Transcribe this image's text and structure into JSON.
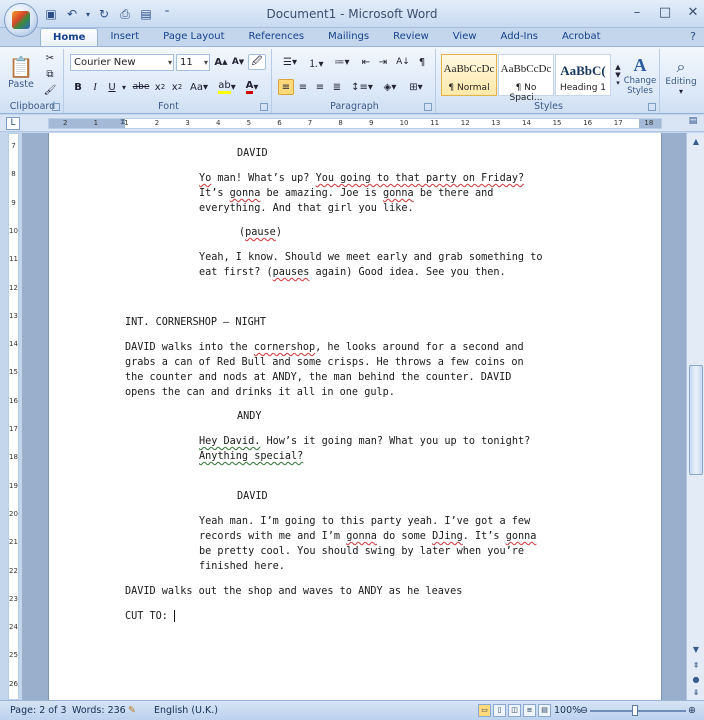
{
  "window": {
    "title": "Document1 - Microsoft Word",
    "minimize": "–",
    "maximize": "□",
    "close": "✕"
  },
  "qat": {
    "items": [
      "save-icon",
      "undo-icon",
      "redo-icon",
      "print-icon",
      "customize-icon"
    ]
  },
  "tabs": [
    "Home",
    "Insert",
    "Page Layout",
    "References",
    "Mailings",
    "Review",
    "View",
    "Add-Ins",
    "Acrobat"
  ],
  "active_tab": "Home",
  "ribbon": {
    "clipboard": {
      "label": "Clipboard",
      "paste": "Paste"
    },
    "font": {
      "label": "Font",
      "family": "Courier New",
      "size": "11"
    },
    "paragraph": {
      "label": "Paragraph"
    },
    "styles": {
      "label": "Styles",
      "items": [
        {
          "sample": "AaBbCcDc",
          "name": "¶ Normal"
        },
        {
          "sample": "AaBbCcDc",
          "name": "¶ No Spaci..."
        },
        {
          "sample": "AaBbC(",
          "name": "Heading 1"
        }
      ],
      "change_styles": "Change Styles"
    },
    "editing": {
      "label": "Editing"
    }
  },
  "ruler": {
    "h_numbers": [
      "2",
      "1",
      "1",
      "2",
      "3",
      "4",
      "5",
      "6",
      "7",
      "8",
      "9",
      "10",
      "11",
      "12",
      "13",
      "14",
      "15",
      "16",
      "17",
      "18"
    ],
    "v_numbers": [
      "7",
      "8",
      "9",
      "10",
      "11",
      "12",
      "13",
      "14",
      "15",
      "16",
      "17",
      "18",
      "19",
      "20",
      "21",
      "22",
      "23",
      "24",
      "25",
      "26"
    ]
  },
  "document": {
    "lines": [
      {
        "indent": "char",
        "text": "DAVID"
      },
      {
        "indent": "dia",
        "parts": [
          [
            "sq",
            "Yo"
          ],
          [
            "",
            " man! What’s up? "
          ],
          [
            "sq",
            "You going to that party on Friday?"
          ]
        ]
      },
      {
        "indent": "dia",
        "parts": [
          [
            "",
            "It’s "
          ],
          [
            "sq",
            "gonna"
          ],
          [
            "",
            " be amazing. Joe is "
          ],
          [
            "sq",
            "gonna"
          ],
          [
            "",
            " be there and"
          ]
        ]
      },
      {
        "indent": "dia",
        "text": "everything. And that girl you like."
      },
      {
        "indent": "par",
        "parts": [
          [
            "",
            "("
          ],
          [
            "sq",
            "pause"
          ],
          [
            "",
            ")"
          ]
        ]
      },
      {
        "indent": "dia",
        "text": "Yeah, I know. Should we meet early and grab something to"
      },
      {
        "indent": "dia",
        "parts": [
          [
            "",
            "eat first? ("
          ],
          [
            "sq",
            "pauses"
          ],
          [
            "",
            " again) Good idea. See you then."
          ]
        ]
      },
      {
        "indent": "act",
        "text": "INT. CORNERSHOP – NIGHT"
      },
      {
        "indent": "act",
        "parts": [
          [
            "",
            "DAVID walks into the "
          ],
          [
            "sq",
            "cornershop"
          ],
          [
            "",
            ", he looks around for a second and"
          ]
        ]
      },
      {
        "indent": "act",
        "text": "grabs a can of Red Bull and some crisps. He throws a few coins on"
      },
      {
        "indent": "act",
        "text": "the counter and nods at ANDY, the man behind the counter. DAVID"
      },
      {
        "indent": "act",
        "text": "opens the can and drinks it all in one gulp."
      },
      {
        "indent": "char",
        "text": "ANDY"
      },
      {
        "indent": "dia",
        "parts": [
          [
            "sqg",
            "Hey David."
          ],
          [
            "",
            " How’s it going man? What you up to tonight?"
          ]
        ]
      },
      {
        "indent": "dia",
        "parts": [
          [
            "sqg",
            "Anything special?"
          ]
        ]
      },
      {
        "indent": "char",
        "text": "DAVID"
      },
      {
        "indent": "dia",
        "text": "Yeah man. I’m going to this party yeah. I’ve got a few"
      },
      {
        "indent": "dia",
        "parts": [
          [
            "",
            "records with me and I’m "
          ],
          [
            "sq",
            "gonna"
          ],
          [
            "",
            " do some "
          ],
          [
            "sq",
            "DJing"
          ],
          [
            "",
            ". It’s "
          ],
          [
            "sq",
            "gonna"
          ]
        ]
      },
      {
        "indent": "dia",
        "text": "be pretty cool. You should swing by later when you’re"
      },
      {
        "indent": "dia",
        "text": "finished here."
      },
      {
        "indent": "act",
        "text": "DAVID walks out the shop and waves to ANDY as he leaves"
      },
      {
        "indent": "act",
        "text": "CUT TO:"
      }
    ]
  },
  "status": {
    "page": "Page: 2 of 3",
    "words": "Words: 236",
    "language": "English (U.K.)",
    "zoom": "100%"
  }
}
